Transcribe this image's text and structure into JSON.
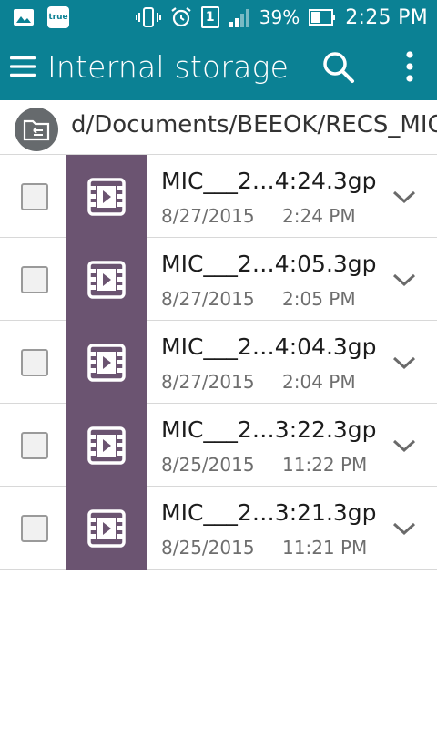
{
  "status_bar": {
    "carrier_badge": "true",
    "sim_number": "1",
    "battery_percent": "39%",
    "time": "2:25 PM",
    "icons": [
      "image-icon",
      "true-app-icon",
      "vibrate-icon",
      "alarm-icon",
      "sim-icon",
      "signal-icon",
      "battery-icon"
    ]
  },
  "app_bar": {
    "title": "Internal storage",
    "icons": [
      "hamburger-menu-icon",
      "search-icon",
      "more-vert-icon"
    ]
  },
  "path_bar": {
    "path": "d/Documents/BEEOK/RECS_MIC/",
    "icon": "folder-swap-icon"
  },
  "files": [
    {
      "name": "MIC___2…4:24.3gp",
      "date": "8/27/2015",
      "time": "2:24 PM",
      "checked": false,
      "icon": "video-file-icon"
    },
    {
      "name": "MIC___2…4:05.3gp",
      "date": "8/27/2015",
      "time": "2:05 PM",
      "checked": false,
      "icon": "video-file-icon"
    },
    {
      "name": "MIC___2…4:04.3gp",
      "date": "8/27/2015",
      "time": "2:04 PM",
      "checked": false,
      "icon": "video-file-icon"
    },
    {
      "name": "MIC___2…3:22.3gp",
      "date": "8/25/2015",
      "time": "11:22 PM",
      "checked": false,
      "icon": "video-file-icon"
    },
    {
      "name": "MIC___2…3:21.3gp",
      "date": "8/25/2015",
      "time": "11:21 PM",
      "checked": false,
      "icon": "video-file-icon"
    }
  ],
  "colors": {
    "accent": "#0b8194",
    "thumb_bg": "#6b5471"
  }
}
